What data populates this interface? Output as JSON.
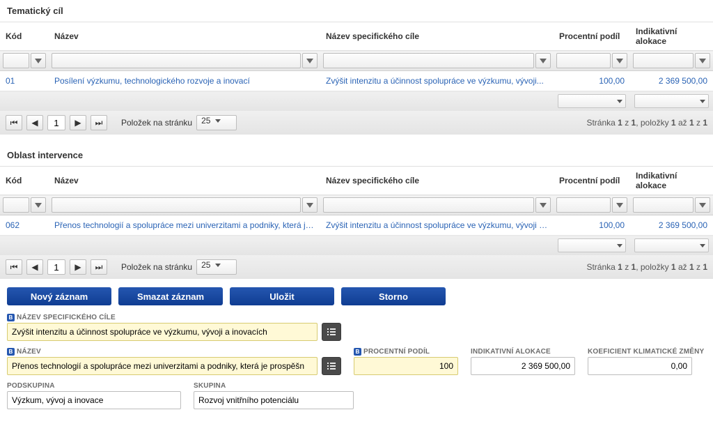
{
  "panels": {
    "tematic": {
      "title": "Tematický cíl",
      "columns": {
        "kod": "Kód",
        "nazev": "Název",
        "spec": "Název specifického cíle",
        "podil": "Procentní podíl",
        "alokace": "Indikativní alokace"
      },
      "row": {
        "kod": "01",
        "nazev": "Posílení výzkumu, technologického rozvoje a inovací",
        "spec": "Zvýšit intenzitu a účinnost spolupráce ve výzkumu, vývoji...",
        "podil": "100,00",
        "alokace": "2 369 500,00"
      }
    },
    "oblast": {
      "title": "Oblast intervence",
      "columns": {
        "kod": "Kód",
        "nazev": "Název",
        "spec": "Název specifického cíle",
        "podil": "Procentní podíl",
        "alokace": "Indikativní alokace"
      },
      "row": {
        "kod": "062",
        "nazev": "Přenos technologií a spolupráce mezi univerzitami a podniky, která je...",
        "spec": "Zvýšit intenzitu a účinnost spolupráce ve výzkumu, vývoji a...",
        "podil": "100,00",
        "alokace": "2 369 500,00"
      }
    }
  },
  "pager": {
    "page": "1",
    "perpage_label": "Položek na stránku",
    "perpage_value": "25",
    "summary_prefix": "Stránka ",
    "summary_mid": " z ",
    "summary_items_prefix": ", položky ",
    "summary_items_mid": " až ",
    "summary_items_suffix": " z ",
    "s_page": "1",
    "s_pages": "1",
    "s_from": "1",
    "s_to": "1",
    "s_total": "1"
  },
  "actions": {
    "novy": "Nový záznam",
    "smazat": "Smazat záznam",
    "ulozit": "Uložit",
    "storno": "Storno"
  },
  "form": {
    "spec_label": "NÁZEV SPECIFICKÉHO CÍLE",
    "spec_value": "Zvýšit intenzitu a účinnost spolupráce ve výzkumu, vývoji a inovacích",
    "nazev_label": "NÁZEV",
    "nazev_value": "Přenos technologií a spolupráce mezi univerzitami a podniky, která je prospěšn",
    "podil_label": "PROCENTNÍ PODÍL",
    "podil_value": "100",
    "alokace_label": "INDIKATIVNÍ ALOKACE",
    "alokace_value": "2 369 500,00",
    "koef_label": "KOEFICIENT KLIMATICKÉ ZMĚNY",
    "koef_value": "0,00",
    "podskupina_label": "PODSKUPINA",
    "podskupina_value": "Výzkum, vývoj a inovace",
    "skupina_label": "SKUPINA",
    "skupina_value": "Rozvoj vnitřního potenciálu"
  }
}
